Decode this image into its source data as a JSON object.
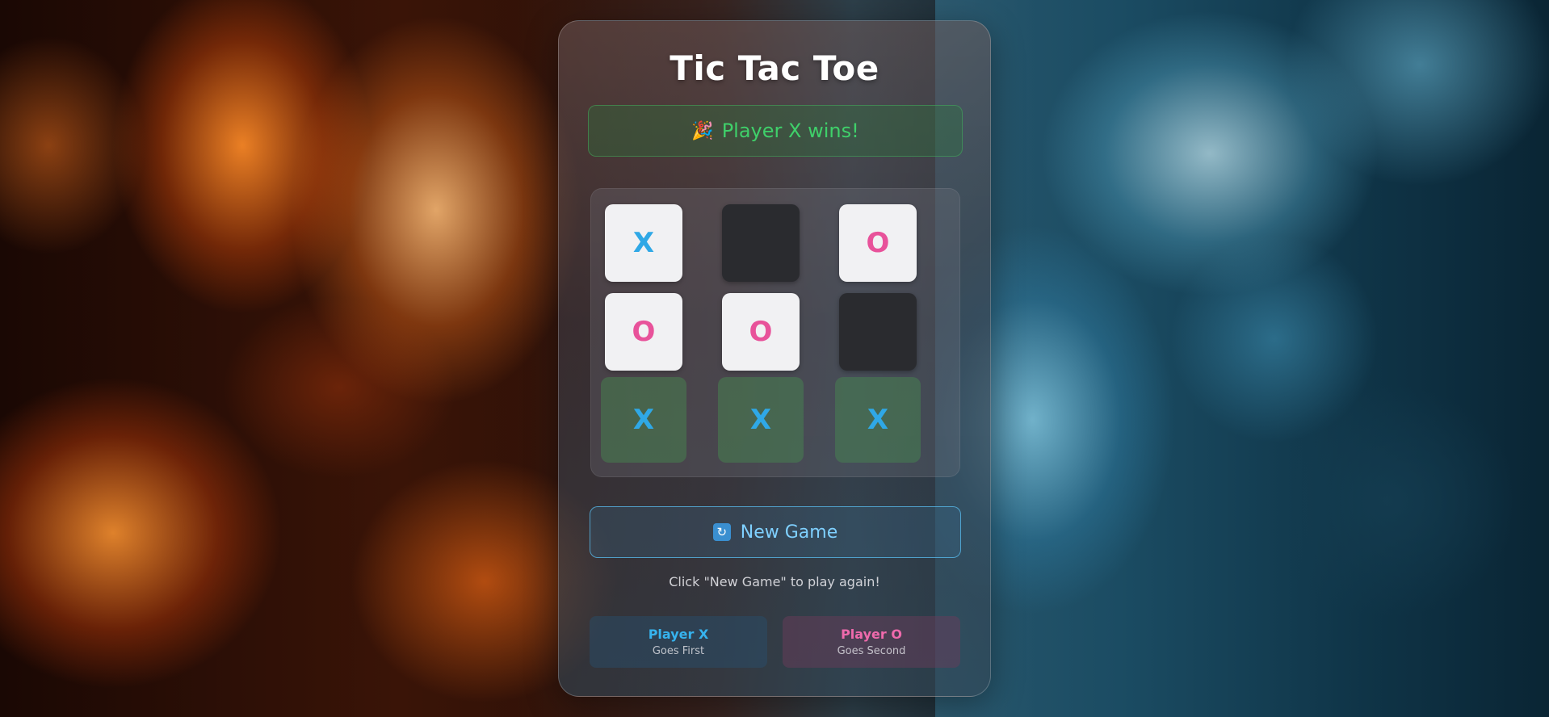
{
  "game": {
    "title": "Tic Tac Toe",
    "status": {
      "icon": "party-popper-icon",
      "emoji": "🎉",
      "text": "Player X wins!"
    },
    "board": [
      [
        "X",
        "",
        "O"
      ],
      [
        "O",
        "O",
        ""
      ],
      [
        "X",
        "X",
        "X"
      ]
    ],
    "winning_row": 2,
    "new_game": {
      "icon": "refresh-icon",
      "glyph": "🔄",
      "label": "New Game"
    },
    "hint": "Click \"New Game\" to play again!",
    "players": {
      "x": {
        "name": "Player X",
        "sub": "Goes First"
      },
      "o": {
        "name": "Player O",
        "sub": "Goes Second"
      }
    }
  },
  "colors": {
    "x_mark": "#2fa8e6",
    "o_mark": "#e8529a",
    "win_text": "#3fd06a",
    "accent": "#7fd0ff"
  }
}
